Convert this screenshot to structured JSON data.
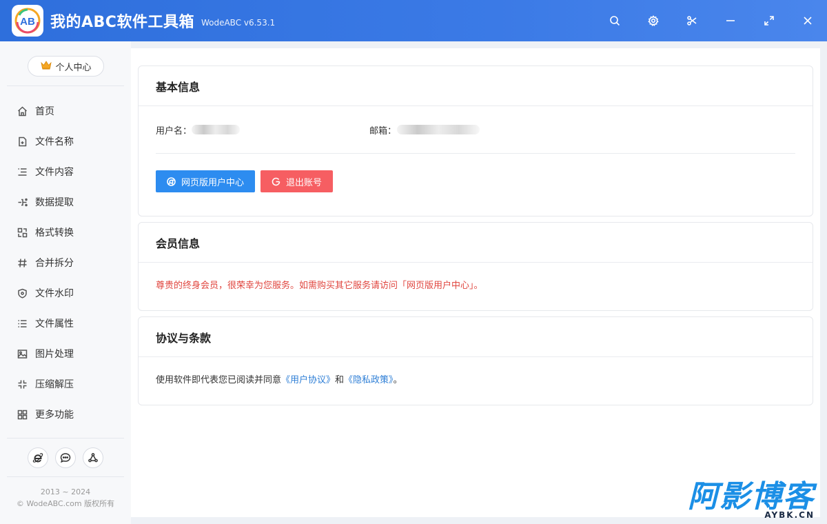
{
  "app": {
    "logo_text": "AB",
    "title": "我的ABC软件工具箱",
    "version": "WodeABC v6.53.1"
  },
  "window_controls": [
    "search-icon",
    "gear-icon",
    "scissors-icon",
    "minimize-icon",
    "maximize-icon",
    "close-icon"
  ],
  "sidebar": {
    "profile_label": "个人中心",
    "profile_icon": "crown-icon",
    "items": [
      {
        "label": "首页",
        "icon": "home-icon"
      },
      {
        "label": "文件名称",
        "icon": "file-rename-icon"
      },
      {
        "label": "文件内容",
        "icon": "list-icon"
      },
      {
        "label": "数据提取",
        "icon": "extract-icon"
      },
      {
        "label": "格式转换",
        "icon": "convert-icon"
      },
      {
        "label": "合并拆分",
        "icon": "hash-icon"
      },
      {
        "label": "文件水印",
        "icon": "shield-icon"
      },
      {
        "label": "文件属性",
        "icon": "list-icon"
      },
      {
        "label": "图片处理",
        "icon": "image-icon"
      },
      {
        "label": "压缩解压",
        "icon": "compress-icon"
      },
      {
        "label": "更多功能",
        "icon": "grid-icon"
      }
    ],
    "social_icons": [
      "ie-browser-icon",
      "chat-bubble-icon",
      "share-network-icon"
    ],
    "copyright_years": "2013 ~ 2024",
    "copyright_text": "© WodeABC.com 版权所有"
  },
  "basic_info": {
    "title": "基本信息",
    "username_label": "用户名：",
    "email_label": "邮箱：",
    "web_center_button": "网页版用户中心",
    "logout_button": "退出账号"
  },
  "member_info": {
    "title": "会员信息",
    "message": "尊贵的终身会员，很荣幸为您服务。如需购买其它服务请访问「网页版用户中心」。"
  },
  "terms": {
    "title": "协议与条款",
    "prefix": "使用软件即代表您已阅读并同意",
    "user_agreement": "《用户协议》",
    "conjunction": "和",
    "privacy_policy": "《隐私政策》",
    "suffix": "。"
  },
  "watermark": {
    "big": "阿影博客",
    "small": "AYBK.CN"
  },
  "colors": {
    "titlebar": "#2e6fdc",
    "primary_button": "#2d8cf0",
    "danger_button": "#f65e62",
    "member_text": "#e0463f",
    "link": "#2d7ed6",
    "watermark": "#1b8fe6"
  }
}
